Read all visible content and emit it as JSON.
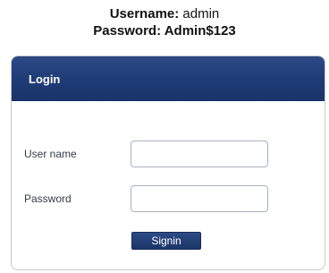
{
  "credentials": {
    "username_label": "Username:",
    "username_value": "admin",
    "password_label": "Password:",
    "password_value": "Admin$123"
  },
  "login_panel": {
    "title": "Login",
    "username_field": {
      "label": "User name",
      "value": ""
    },
    "password_field": {
      "label": "Password",
      "value": ""
    },
    "signin_label": "Signin"
  },
  "colors": {
    "header_blue": "#1f3b76",
    "button_blue": "#24407a",
    "input_border": "#a9b1bf"
  }
}
